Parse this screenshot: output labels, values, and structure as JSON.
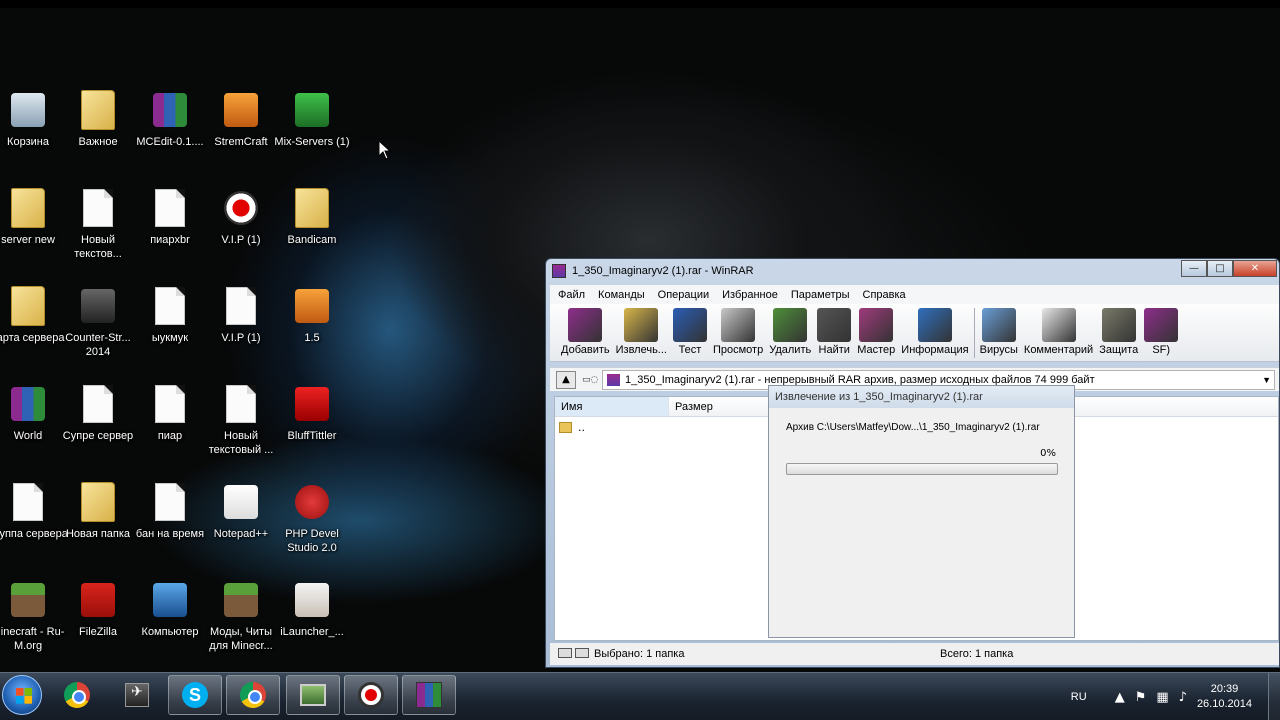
{
  "desktop": {
    "icons": [
      {
        "label": "Корзина",
        "icon": "recycle-bin-icon"
      },
      {
        "label": "Важное",
        "icon": "folder-icon"
      },
      {
        "label": "MCEdit-0.1....",
        "icon": "winrar-archive-icon"
      },
      {
        "label": "StremCraft",
        "icon": "app-icon"
      },
      {
        "label": "Mix-Servers (1)",
        "icon": "creeper-icon"
      },
      {
        "label": "server new",
        "icon": "folder-icon"
      },
      {
        "label": "Новый текстов...",
        "icon": "text-document-icon"
      },
      {
        "label": "пиарxbr",
        "icon": "text-document-icon"
      },
      {
        "label": "V.I.P (1)",
        "icon": "record-icon"
      },
      {
        "label": "Bandicam",
        "icon": "folder-icon"
      },
      {
        "label": "карта сервера",
        "icon": "folder-icon"
      },
      {
        "label": "Counter-Str... 2014",
        "icon": "counter-strike-icon"
      },
      {
        "label": "ыукмук",
        "icon": "text-document-icon"
      },
      {
        "label": "V.I.P (1)",
        "icon": "text-document-icon"
      },
      {
        "label": "1.5",
        "icon": "app-icon"
      },
      {
        "label": "World",
        "icon": "winrar-archive-icon"
      },
      {
        "label": "Супре сервер",
        "icon": "text-document-icon"
      },
      {
        "label": "пиар",
        "icon": "text-document-icon"
      },
      {
        "label": "Новый текстовый ...",
        "icon": "text-document-icon"
      },
      {
        "label": "BluffTittler",
        "icon": "bluff-titler-icon"
      },
      {
        "label": "Группа сервера",
        "icon": "text-document-icon"
      },
      {
        "label": "Новая папка",
        "icon": "folder-icon"
      },
      {
        "label": "бан на время",
        "icon": "text-document-icon"
      },
      {
        "label": "Notepad++",
        "icon": "notepad-icon"
      },
      {
        "label": "PHP Devel Studio 2.0",
        "icon": "soul-icon"
      },
      {
        "label": "Minecraft - Ru-M.org",
        "icon": "minecraft-icon"
      },
      {
        "label": "FileZilla",
        "icon": "filezilla-icon"
      },
      {
        "label": "Компьютер",
        "icon": "computer-icon"
      },
      {
        "label": "Моды, Читы для Minecr...",
        "icon": "minecraft-icon"
      },
      {
        "label": "iLauncher_...",
        "icon": "sheep-icon"
      }
    ]
  },
  "window": {
    "title": "1_350_Imaginaryv2 (1).rar - WinRAR",
    "buttons": {
      "minimize": "—",
      "maximize": "□",
      "close": "✕"
    },
    "menu": [
      "Файл",
      "Команды",
      "Операции",
      "Избранное",
      "Параметры",
      "Справка"
    ],
    "toolbar": [
      {
        "label": "Добавить",
        "color": "#8e2d8b"
      },
      {
        "label": "Извлечь...",
        "color": "#d9b64a"
      },
      {
        "label": "Тест",
        "color": "#2a5db5"
      },
      {
        "label": "Просмотр",
        "color": "#c9c9c9"
      },
      {
        "label": "Удалить",
        "color": "#4f8f3a"
      },
      {
        "label": "Найти",
        "color": "#555555"
      },
      {
        "label": "Мастер",
        "color": "#a03a7c"
      },
      {
        "label": "Информация",
        "color": "#2f6fbf"
      },
      {
        "label": "Вирусы",
        "color": "#6a9fd8"
      },
      {
        "label": "Комментарий",
        "color": "#e8e8e8"
      },
      {
        "label": "Защита",
        "color": "#7a7a6a"
      },
      {
        "label": "SF)",
        "color": "#8e2d8b"
      }
    ],
    "address": "1_350_Imaginaryv2 (1).rar - непрерывный RAR архив, размер исходных файлов 74 999 байт",
    "columns": {
      "name": "Имя",
      "size": "Размер"
    },
    "rows": [
      {
        "name": ".."
      }
    ],
    "status_left": "Выбрано: 1 папка",
    "status_right": "Всего: 1 папка"
  },
  "extract_dialog": {
    "title": "Извлечение из 1_350_Imaginaryv2 (1).rar",
    "path": "Архив C:\\Users\\Matfey\\Dow...\\1_350_Imaginaryv2 (1).rar",
    "percent_text": "0%",
    "progress": 0
  },
  "taskbar": {
    "apps": [
      "chrome",
      "counter-strike",
      "skype",
      "chrome",
      "minecraft-server",
      "bandicam",
      "winrar"
    ],
    "lang": "RU",
    "time": "20:39",
    "date": "26.10.2014"
  }
}
